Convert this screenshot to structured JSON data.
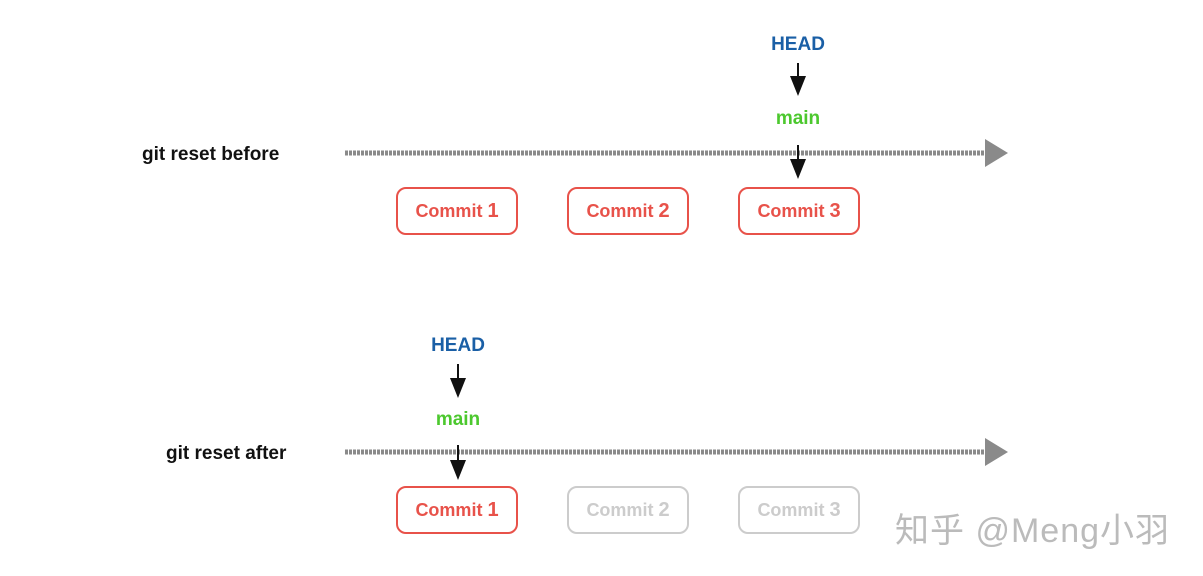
{
  "colors": {
    "head": "#1a5fa6",
    "branch": "#4cc82e",
    "commit_active": "#e8524a",
    "commit_inactive": "#cccccc",
    "timeline": "#8a8a8a",
    "pointer_arrow": "#111111"
  },
  "before": {
    "label": "git reset before",
    "head": "HEAD",
    "branch": "main",
    "commits": [
      {
        "word": "Commit",
        "num": "1",
        "active": true
      },
      {
        "word": "Commit",
        "num": "2",
        "active": true
      },
      {
        "word": "Commit",
        "num": "3",
        "active": true
      }
    ]
  },
  "after": {
    "label": "git reset after",
    "head": "HEAD",
    "branch": "main",
    "commits": [
      {
        "word": "Commit",
        "num": "1",
        "active": true
      },
      {
        "word": "Commit",
        "num": "2",
        "active": false
      },
      {
        "word": "Commit",
        "num": "3",
        "active": false
      }
    ]
  },
  "watermark": "知乎 @Meng小羽"
}
